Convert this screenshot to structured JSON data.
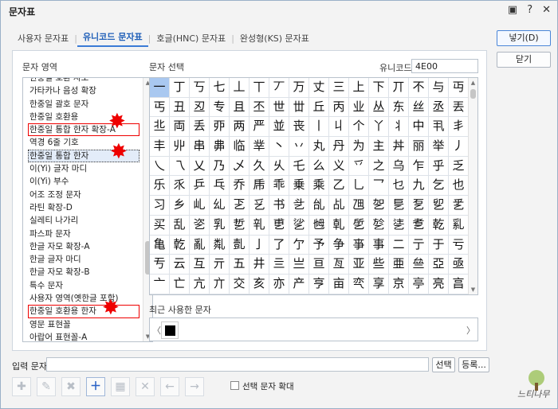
{
  "window": {
    "title": "문자표",
    "icons": [
      "chat-icon",
      "help-icon",
      "close-icon"
    ]
  },
  "tabs": [
    {
      "label": "사용자 문자표",
      "active": false
    },
    {
      "label": "유니코드 문자표",
      "active": true
    },
    {
      "label": "호글(HNC) 문자표",
      "active": false
    },
    {
      "label": "완성형(KS) 문자표",
      "active": false
    }
  ],
  "left": {
    "label": "문자 영역",
    "items": [
      "한중일 호환 자모",
      "가타카나 음성 확장",
      "한중일 괄호 문자",
      "한중일 호환용",
      "한중일 통합 한자 확장-A",
      "역경 6줄 기호",
      "한중일 통합 한자",
      "이(Yi) 글자 마디",
      "이(Yi) 부수",
      "어조 조정 문자",
      "라틴 확장-D",
      "실레티 나가리",
      "파스파 문자",
      "한글 자모 확장-A",
      "한글 글자 마디",
      "한글 자모 확장-B",
      "특수 문자",
      "사용자 영역(옛한글 포함)",
      "한중일 호환용 한자",
      "영문 표현꼴",
      "아랍어 표현꼴-A"
    ]
  },
  "right": {
    "label": "문자 선택",
    "unicode_label": "유니코드",
    "unicode_value": "4E00",
    "chars": "一丁丂七丄丅丆万丈三上下丌不与丏丐丑丒专且丕世丗丘丙业丛东丝丞丟丠両丢丣两严並丧丨丩个丫丬中丮丯丰丱串丳临丵丶丷丸丹为主丼丽举丿乀乁乂乃乄久乆乇么义乊之乌乍乎乏乐乑乒乓乔乕乖乗乘乙乚乛乜九乞也习乡乢乣乤乥书乧乨乩乪乫乬乭乮乯买乱乲乳乴乵乶乷乸乹乺乻乼乽乾乿亀亁亂亃亄亅了亇予争亊事二亍于亏亐云互亓五井亖亗亘亙亚些亜亝亞亟亠亡亢亣交亥亦产亨亩亪享京亭亮亯"
  },
  "recent": {
    "label": "최근 사용한 문자",
    "char": "■"
  },
  "buttons": {
    "insert": "넣기(D)",
    "close": "닫기",
    "select": "선택",
    "register": "등록..."
  },
  "input": {
    "label": "입력 문자",
    "value": ""
  },
  "toolbar": {
    "icons": [
      "add-char-icon",
      "edit-char-icon",
      "delete-char-icon",
      "plus-icon",
      "table-icon",
      "x-icon",
      "arrow-left-icon",
      "arrow-right-icon"
    ],
    "enlarge_label": "선택 문자 확대"
  },
  "watermark": {
    "text": "느티나무"
  }
}
